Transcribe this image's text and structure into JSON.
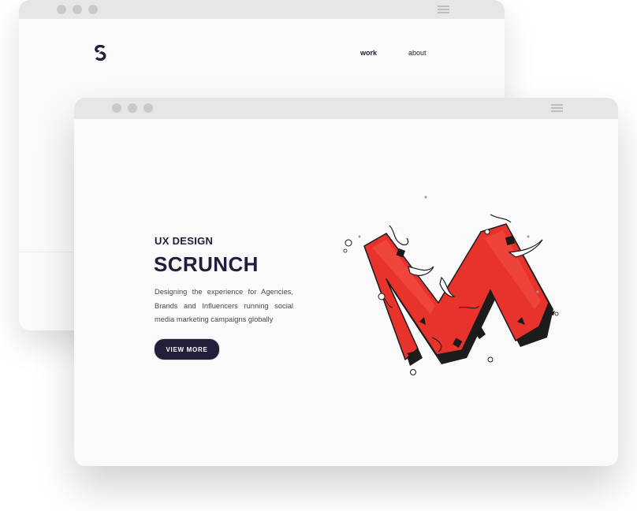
{
  "back_window": {
    "nav": {
      "work_label": "work",
      "about_label": "about"
    },
    "icons": {
      "logo": "s-logo",
      "menu": "hamburger-icon"
    }
  },
  "front_window": {
    "hero": {
      "eyebrow": "UX DESIGN",
      "title": "SCRUNCH",
      "description": "Designing the experience for Agencies, Brands and Influencers running social media marketing campaigns globally",
      "cta_label": "VIEW MORE"
    },
    "icons": {
      "menu": "hamburger-icon",
      "artwork": "red-m-sculpture"
    }
  },
  "colors": {
    "navy": "#221d3d",
    "accent_red": "#e8322c",
    "titlebar": "#e6e6e6",
    "dot": "#c9c9c9"
  }
}
